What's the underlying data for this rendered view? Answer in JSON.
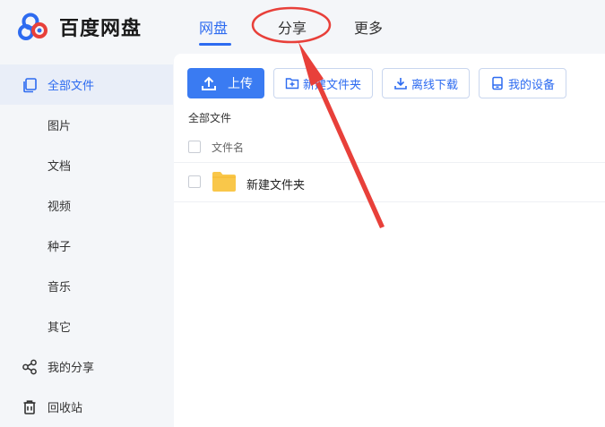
{
  "app": {
    "logo_text": "百度网盘"
  },
  "nav": {
    "tabs": [
      {
        "label": "网盘"
      },
      {
        "label": "分享"
      },
      {
        "label": "更多"
      }
    ]
  },
  "sidebar": {
    "items": [
      {
        "label": "全部文件",
        "icon": "files-icon"
      },
      {
        "label": "图片"
      },
      {
        "label": "文档"
      },
      {
        "label": "视频"
      },
      {
        "label": "种子"
      },
      {
        "label": "音乐"
      },
      {
        "label": "其它"
      },
      {
        "label": "我的分享",
        "icon": "share-icon"
      },
      {
        "label": "回收站",
        "icon": "trash-icon"
      }
    ]
  },
  "toolbar": {
    "upload_label": "上传",
    "new_folder_label": "新建文件夹",
    "offline_download_label": "离线下载",
    "my_devices_label": "我的设备"
  },
  "breadcrumb": "全部文件",
  "file_table": {
    "header_name": "文件名",
    "rows": [
      {
        "name": "新建文件夹",
        "type": "folder"
      }
    ]
  },
  "colors": {
    "accent": "#2d6bf0",
    "annotation": "#e8403a",
    "folder": "#f9c74a"
  }
}
